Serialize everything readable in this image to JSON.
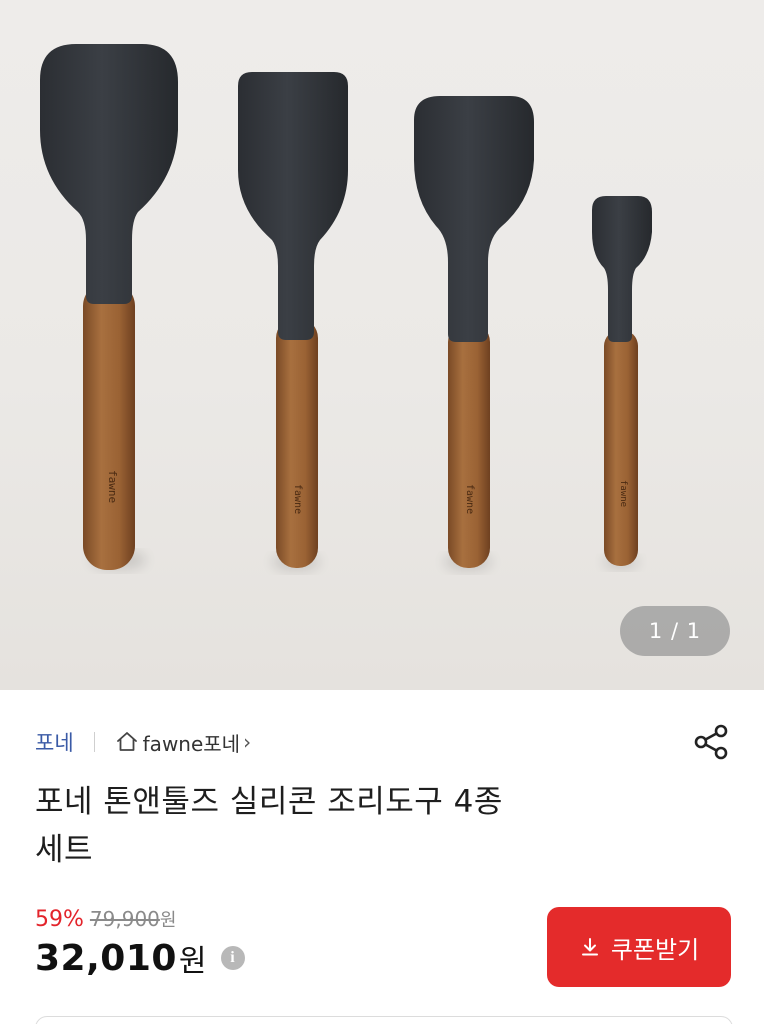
{
  "hero": {
    "counter": "1 / 1",
    "engravings": [
      "fawne",
      "fawne",
      "fawne",
      "fawne"
    ]
  },
  "brand": {
    "name": "포네",
    "store_name": "fawne포네",
    "store_chevron": "›"
  },
  "product": {
    "title_line1": "포네 톤앤툴즈 실리콘 조리도구 4종",
    "title_line2": "세트"
  },
  "price": {
    "discount_rate": "59%",
    "original_price": "79,900",
    "original_unit": "원",
    "sale_price": "32,010",
    "sale_unit": "원",
    "info_glyph": "i"
  },
  "coupon": {
    "label": "쿠폰받기"
  },
  "colors": {
    "accent_red": "#e42b2b",
    "brand_blue": "#3a5aa6"
  },
  "icons": {
    "share": "share-icon",
    "home": "home-icon",
    "download": "download-icon",
    "info": "info-icon"
  }
}
